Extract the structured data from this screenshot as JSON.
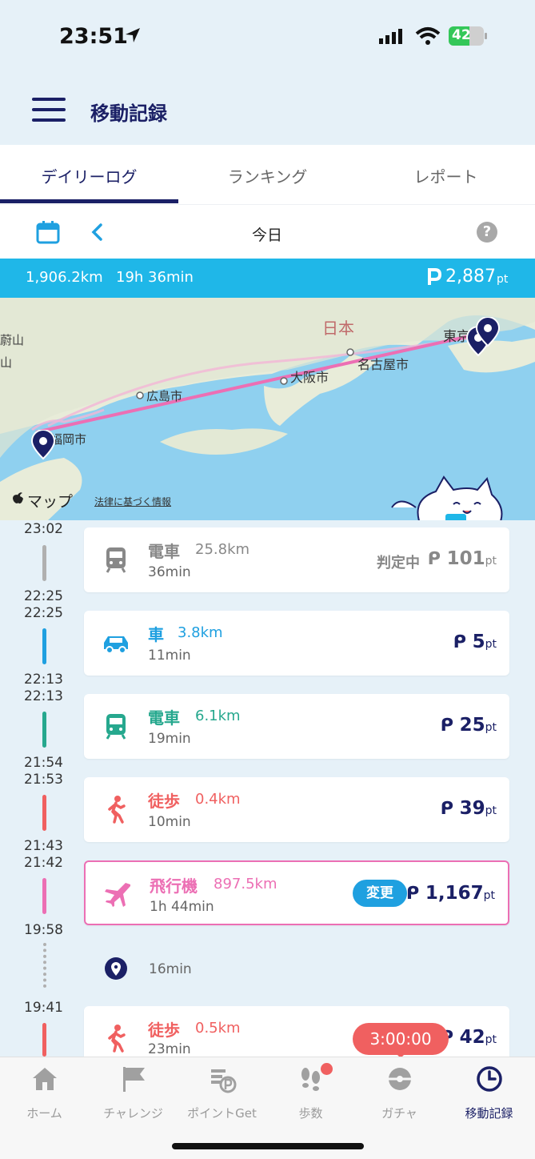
{
  "status": {
    "time": "23:51",
    "battery": "42"
  },
  "header": {
    "title": "移動記録"
  },
  "tabs": [
    {
      "label": "デイリーログ"
    },
    {
      "label": "ランキング"
    },
    {
      "label": "レポート"
    }
  ],
  "datebar": {
    "date": "今日"
  },
  "summary": {
    "distance": "1,906.2km",
    "duration": "19h 36min",
    "points": "2,887",
    "pt": "pt"
  },
  "map": {
    "labels": {
      "japan": "日本",
      "tokyo": "東京",
      "nagoya": "名古屋市",
      "osaka": "大阪市",
      "hiroshima": "広島市",
      "fukuoka": "福岡市",
      "left1": "蔚山",
      "left2": "山"
    },
    "attribution": "マップ",
    "legal": "法律に基づく情報"
  },
  "timeline": {
    "times": [
      "23:02",
      "22:25",
      "22:25",
      "22:13",
      "22:13",
      "21:54",
      "21:53",
      "21:43",
      "21:42",
      "19:58",
      "19:41"
    ],
    "stay_duration": "16min",
    "entries": [
      {
        "mode": "電車",
        "distance": "25.8km",
        "duration": "36min",
        "status": "判定中",
        "points": "101",
        "pt": "pt"
      },
      {
        "mode": "車",
        "distance": "3.8km",
        "duration": "11min",
        "points": "5",
        "pt": "pt"
      },
      {
        "mode": "電車",
        "distance": "6.1km",
        "duration": "19min",
        "points": "25",
        "pt": "pt"
      },
      {
        "mode": "徒歩",
        "distance": "0.4km",
        "duration": "10min",
        "points": "39",
        "pt": "pt"
      },
      {
        "mode": "飛行機",
        "distance": "897.5km",
        "duration": "1h 44min",
        "change": "変更",
        "points": "1,167",
        "pt": "pt"
      },
      {
        "mode": "徒歩",
        "distance": "0.5km",
        "duration": "23min",
        "points": "42",
        "pt": "pt"
      }
    ]
  },
  "timer": "3:00:00",
  "colors": {
    "navy": "#1b2066",
    "blue": "#1fa0e0",
    "teal": "#26a88e",
    "red": "#f06060",
    "pink": "#ec6fb4",
    "gray": "#888888"
  },
  "nav": [
    {
      "label": "ホーム",
      "icon": "home-icon"
    },
    {
      "label": "チャレンジ",
      "icon": "flag-icon"
    },
    {
      "label": "ポイントGet",
      "icon": "points-icon"
    },
    {
      "label": "歩数",
      "icon": "footsteps-icon"
    },
    {
      "label": "ガチャ",
      "icon": "gacha-icon"
    },
    {
      "label": "移動記録",
      "icon": "clock-icon"
    }
  ]
}
